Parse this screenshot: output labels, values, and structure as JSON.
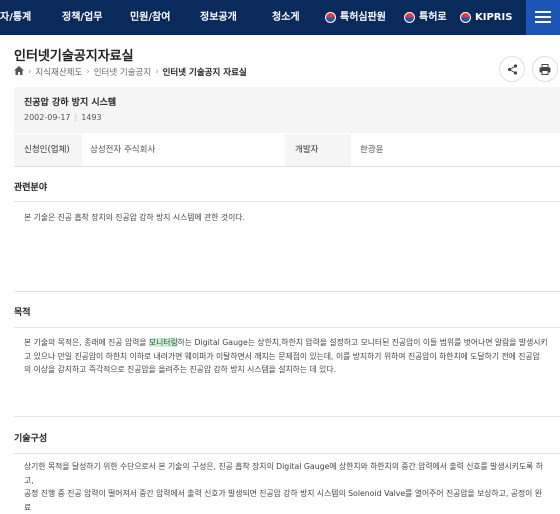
{
  "nav": {
    "items": [
      "자/통계",
      "정책/업무",
      "민원/참여",
      "정보공개",
      "청소게"
    ],
    "ext_links": [
      "특허심판원",
      "특허로",
      "KIPRIS"
    ],
    "menu_icon": "hamburger-icon"
  },
  "page": {
    "title": "인터넷기술공지자료실",
    "breadcrumb": [
      "지식재산제도",
      "인터넷 기술공지",
      "인터넷 기술공지 자료실"
    ]
  },
  "article": {
    "title": "진공압 강하 방지 시스템",
    "date": "2002-09-17",
    "views": "1493"
  },
  "info": {
    "applicant_label": "신청인(업체)",
    "applicant_value": "삼성전자 주식회사",
    "developer_label": "개발자",
    "developer_value": "한광윤"
  },
  "sections": {
    "field_title": "관련분야",
    "field_text": "본 기술은 진공 흡착 장치의 진공압 강하 방지 시스템에 관한 것이다.",
    "purpose_title": "목적",
    "purpose_line1_pre": "본 기술의 목적은, 종래에 진공 압력을 ",
    "purpose_line1_hl": "모니터링",
    "purpose_line1_post": "하는 Digital Gauge는 상한치,하한치 압력을 설정하고 모니터된 진공압이 이들 범위를 벗어나면 알람을 발생시키",
    "purpose_line2": "고 있으나 만일 진공압이 하한치 이하로 내려가면 웨이퍼가 이탈하면서 깨지는 문제점이 있는데, 이를 방지하기 위하여 진공압이 하한치에 도달하기 전에 진공압",
    "purpose_line3": "의 이상을 감지하고 즉각적으로 진공압을 올려주는 진공압 강하 방지 시스템을 설치하는 데 있다.",
    "composition_title": "기술구성",
    "composition_line1": "상기한 목적을 달성하기 위한 수단으로서 본 기술의 구성은, 진공 흡착 장치의 Digital Gauge에 상한치와 하한치의 중간 압력에서 출력 신호를 발생시키도록 하고,",
    "composition_line2": "공정 진행 중 진공 압력이 떨어져서 중간 압력에서 출력 신호가 발생되면 진공압 강하 방지 시스템의 Solenoid Valve를 열어주어 진공압을 보상하고, 공정이 완료"
  },
  "colors": {
    "nav_bg": "#0a2a5c",
    "menu_bg": "#1c55b5",
    "highlight": "#c8f1d6"
  },
  "icons": [
    "home-icon",
    "share-icon",
    "print-icon",
    "hamburger-icon"
  ]
}
